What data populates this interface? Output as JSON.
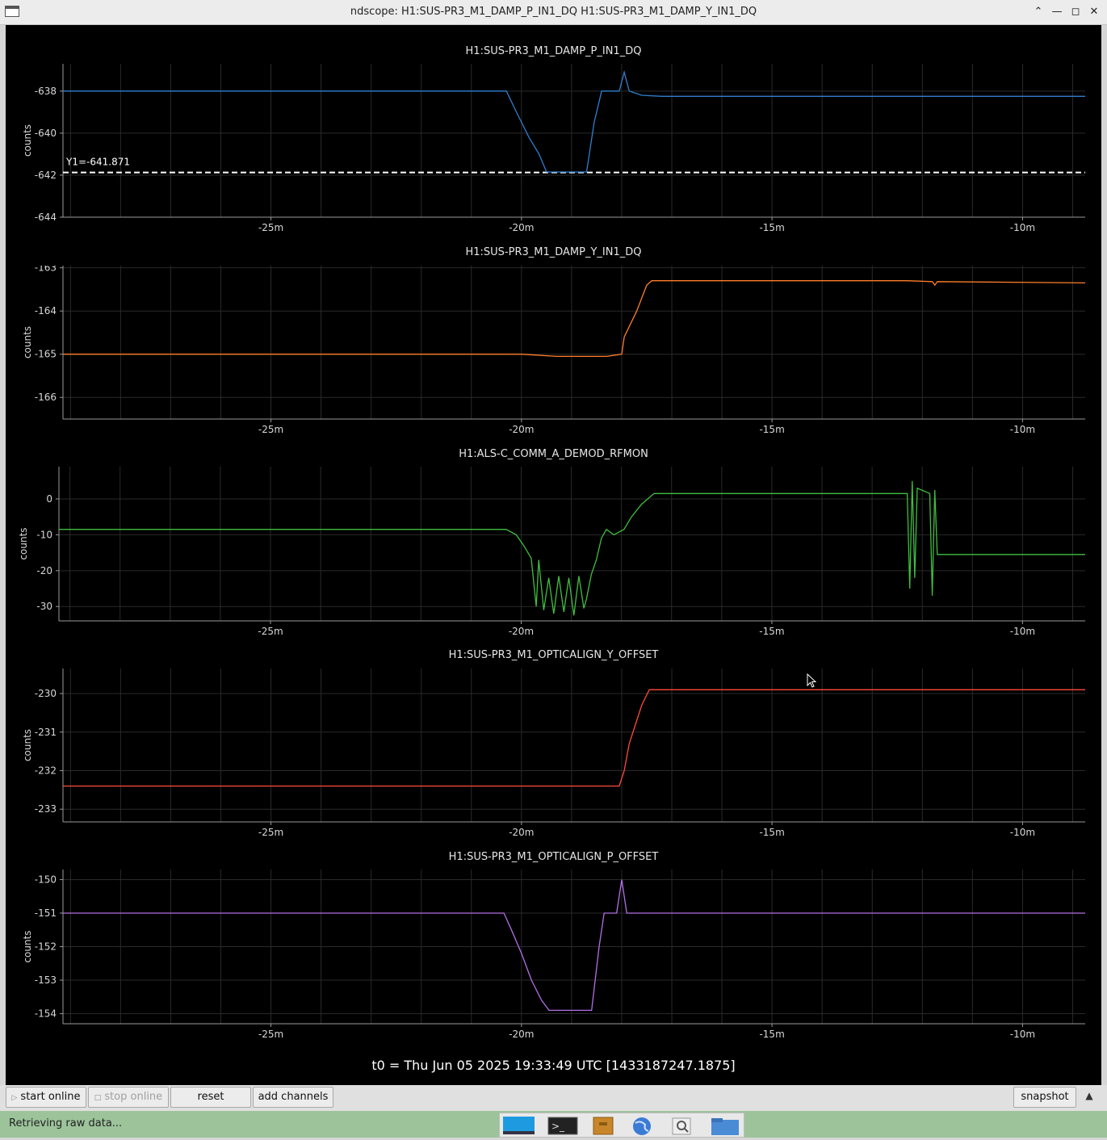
{
  "window": {
    "title": "ndscope: H1:SUS-PR3_M1_DAMP_P_IN1_DQ H1:SUS-PR3_M1_DAMP_Y_IN1_DQ"
  },
  "icons": {
    "app": "window-icon",
    "minimize": "minimize-icon",
    "maximize": "maximize-icon",
    "close": "close-icon",
    "shade": "shade-up-icon"
  },
  "time_axis": {
    "ticks": [
      "-25m",
      "-20m",
      "-15m",
      "-10m"
    ]
  },
  "chart_data": [
    {
      "type": "line",
      "title": "H1:SUS-PR3_M1_DAMP_P_IN1_DQ",
      "ylabel": "counts",
      "color": "#2f7fcf",
      "xlim": [
        -29.15,
        -8.75
      ],
      "ylim": [
        -644,
        -636.7
      ],
      "yticks": [
        -638,
        -640,
        -642,
        -644
      ],
      "grid": true,
      "cursor": {
        "label": "Y1=-641.871",
        "y": -641.871
      },
      "points": [
        [
          -29.15,
          -638.0
        ],
        [
          -20.3,
          -638.0
        ],
        [
          -20.1,
          -639.0
        ],
        [
          -19.85,
          -640.2
        ],
        [
          -19.65,
          -641.0
        ],
        [
          -19.5,
          -641.85
        ],
        [
          -18.7,
          -641.85
        ],
        [
          -18.55,
          -639.5
        ],
        [
          -18.4,
          -638.0
        ],
        [
          -18.05,
          -638.0
        ],
        [
          -17.95,
          -637.1
        ],
        [
          -17.85,
          -638.0
        ],
        [
          -17.6,
          -638.2
        ],
        [
          -17.2,
          -638.25
        ],
        [
          -8.75,
          -638.25
        ]
      ]
    },
    {
      "type": "line",
      "title": "H1:SUS-PR3_M1_DAMP_Y_IN1_DQ",
      "ylabel": "counts",
      "color": "#ff7f2a",
      "xlim": [
        -29.15,
        -8.75
      ],
      "ylim": [
        -166.5,
        -162.95
      ],
      "yticks": [
        -163,
        -164,
        -165,
        -166
      ],
      "grid": true,
      "points": [
        [
          -29.15,
          -165.0
        ],
        [
          -22.0,
          -165.0
        ],
        [
          -20.0,
          -165.0
        ],
        [
          -19.3,
          -165.05
        ],
        [
          -18.3,
          -165.05
        ],
        [
          -18.0,
          -165.0
        ],
        [
          -17.95,
          -164.6
        ],
        [
          -17.7,
          -164.0
        ],
        [
          -17.5,
          -163.4
        ],
        [
          -17.4,
          -163.3
        ],
        [
          -12.3,
          -163.3
        ],
        [
          -11.8,
          -163.32
        ],
        [
          -11.75,
          -163.4
        ],
        [
          -11.7,
          -163.32
        ],
        [
          -8.75,
          -163.35
        ]
      ]
    },
    {
      "type": "line",
      "title": "H1:ALS-C_COMM_A_DEMOD_RFMON",
      "ylabel": "counts",
      "color": "#3fbf3f",
      "xlim": [
        -29.22,
        -8.75
      ],
      "ylim": [
        -34,
        9
      ],
      "yticks": [
        0,
        -10,
        -20,
        -30
      ],
      "grid": true,
      "points": [
        [
          -29.22,
          -8.5
        ],
        [
          -20.3,
          -8.5
        ],
        [
          -20.1,
          -10.0
        ],
        [
          -19.95,
          -13.0
        ],
        [
          -19.8,
          -16.5
        ],
        [
          -19.7,
          -30.0
        ],
        [
          -19.65,
          -17.0
        ],
        [
          -19.55,
          -31.0
        ],
        [
          -19.45,
          -22.0
        ],
        [
          -19.35,
          -32.0
        ],
        [
          -19.25,
          -21.5
        ],
        [
          -19.15,
          -31.5
        ],
        [
          -19.05,
          -22.0
        ],
        [
          -18.95,
          -32.5
        ],
        [
          -18.85,
          -21.5
        ],
        [
          -18.75,
          -30.5
        ],
        [
          -18.7,
          -28.0
        ],
        [
          -18.6,
          -21.0
        ],
        [
          -18.5,
          -17.0
        ],
        [
          -18.4,
          -11.0
        ],
        [
          -18.3,
          -8.5
        ],
        [
          -18.15,
          -10.0
        ],
        [
          -17.95,
          -8.5
        ],
        [
          -17.8,
          -5.0
        ],
        [
          -17.6,
          -1.5
        ],
        [
          -17.35,
          1.5
        ],
        [
          -12.3,
          1.5
        ],
        [
          -12.25,
          -25.0
        ],
        [
          -12.2,
          5.0
        ],
        [
          -12.15,
          -22.0
        ],
        [
          -12.1,
          3.0
        ],
        [
          -11.85,
          1.5
        ],
        [
          -11.8,
          -27.0
        ],
        [
          -11.75,
          2.5
        ],
        [
          -11.7,
          -15.5
        ],
        [
          -8.75,
          -15.5
        ]
      ]
    },
    {
      "type": "line",
      "title": "H1:SUS-PR3_M1_OPTICALIGN_Y_OFFSET",
      "ylabel": "counts",
      "color": "#ff4a3a",
      "xlim": [
        -29.15,
        -8.75
      ],
      "ylim": [
        -233.33,
        -229.35
      ],
      "yticks": [
        -230,
        -231,
        -232,
        -233
      ],
      "grid": true,
      "points": [
        [
          -29.15,
          -232.4
        ],
        [
          -18.05,
          -232.4
        ],
        [
          -17.95,
          -232.0
        ],
        [
          -17.85,
          -231.3
        ],
        [
          -17.75,
          -230.9
        ],
        [
          -17.6,
          -230.3
        ],
        [
          -17.45,
          -229.9
        ],
        [
          -8.75,
          -229.9
        ]
      ]
    },
    {
      "type": "line",
      "title": "H1:SUS-PR3_M1_OPTICALIGN_P_OFFSET",
      "ylabel": "counts",
      "color": "#b26fe6",
      "xlim": [
        -29.15,
        -8.75
      ],
      "ylim": [
        -154.3,
        -149.7
      ],
      "yticks": [
        -150,
        -151,
        -152,
        -153,
        -154
      ],
      "grid": true,
      "points": [
        [
          -29.15,
          -151.0
        ],
        [
          -20.35,
          -151.0
        ],
        [
          -20.2,
          -151.5
        ],
        [
          -20.0,
          -152.2
        ],
        [
          -19.8,
          -153.0
        ],
        [
          -19.6,
          -153.6
        ],
        [
          -19.45,
          -153.9
        ],
        [
          -18.6,
          -153.9
        ],
        [
          -18.45,
          -152.0
        ],
        [
          -18.35,
          -151.0
        ],
        [
          -18.1,
          -151.0
        ],
        [
          -18.0,
          -150.0
        ],
        [
          -17.9,
          -151.0
        ],
        [
          -8.75,
          -151.0
        ]
      ]
    }
  ],
  "t0_label": "t0 = Thu Jun 05 2025 19:33:49 UTC [1433187247.1875]",
  "toolbar": {
    "start_online": "start online",
    "stop_online": "stop online",
    "reset": "reset",
    "add_channels": "add channels",
    "snapshot": "snapshot"
  },
  "status": {
    "text": "Retrieving raw data..."
  },
  "taskbar": {
    "apps": [
      "desktop-icon",
      "terminal-icon",
      "archive-icon",
      "browser-icon",
      "search-icon",
      "folder-icon"
    ]
  }
}
